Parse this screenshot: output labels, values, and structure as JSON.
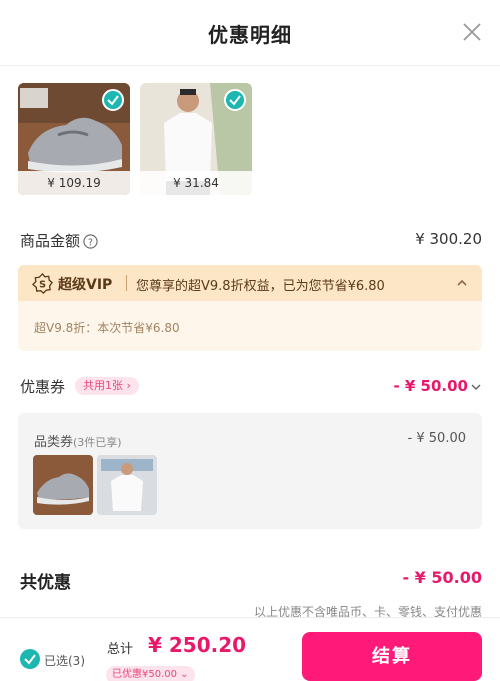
{
  "header": {
    "title": "优惠明细",
    "close_icon": "close-icon"
  },
  "products": [
    {
      "name": "sneaker",
      "price": "¥ 109.19",
      "selected": true
    },
    {
      "name": "white-tshirt",
      "price": "¥ 31.84",
      "selected": true
    }
  ],
  "amount": {
    "label": "商品金额",
    "value": "¥ 300.20"
  },
  "vip": {
    "brand": "超级VIP",
    "message": "您尊享的超V9.8折权益，已为您节省¥6.80",
    "detail": "超V9.8折：本次节省¥6.80"
  },
  "coupon": {
    "label": "优惠券",
    "pill": "共用1张 ›",
    "value": "- ¥ 50.00"
  },
  "category_coupon": {
    "label": "品类券",
    "note": "(3件已享)",
    "value": "- ¥ 50.00"
  },
  "total_discount": {
    "label": "共优惠",
    "value": "- ¥ 50.00",
    "note": "以上优惠不含唯品币、卡、零钱、支付优惠"
  },
  "footer": {
    "selected": "已选(3)",
    "total_label": "总计",
    "total_value": "¥ 250.20",
    "discount_pill": "已优惠¥50.00 ⌄",
    "pay_button": "结算"
  },
  "colors": {
    "accent": "#ff1a7a",
    "price_pink": "#e8196b",
    "check_teal": "#1bb7b0",
    "vip_bg": "#fde6c6"
  }
}
